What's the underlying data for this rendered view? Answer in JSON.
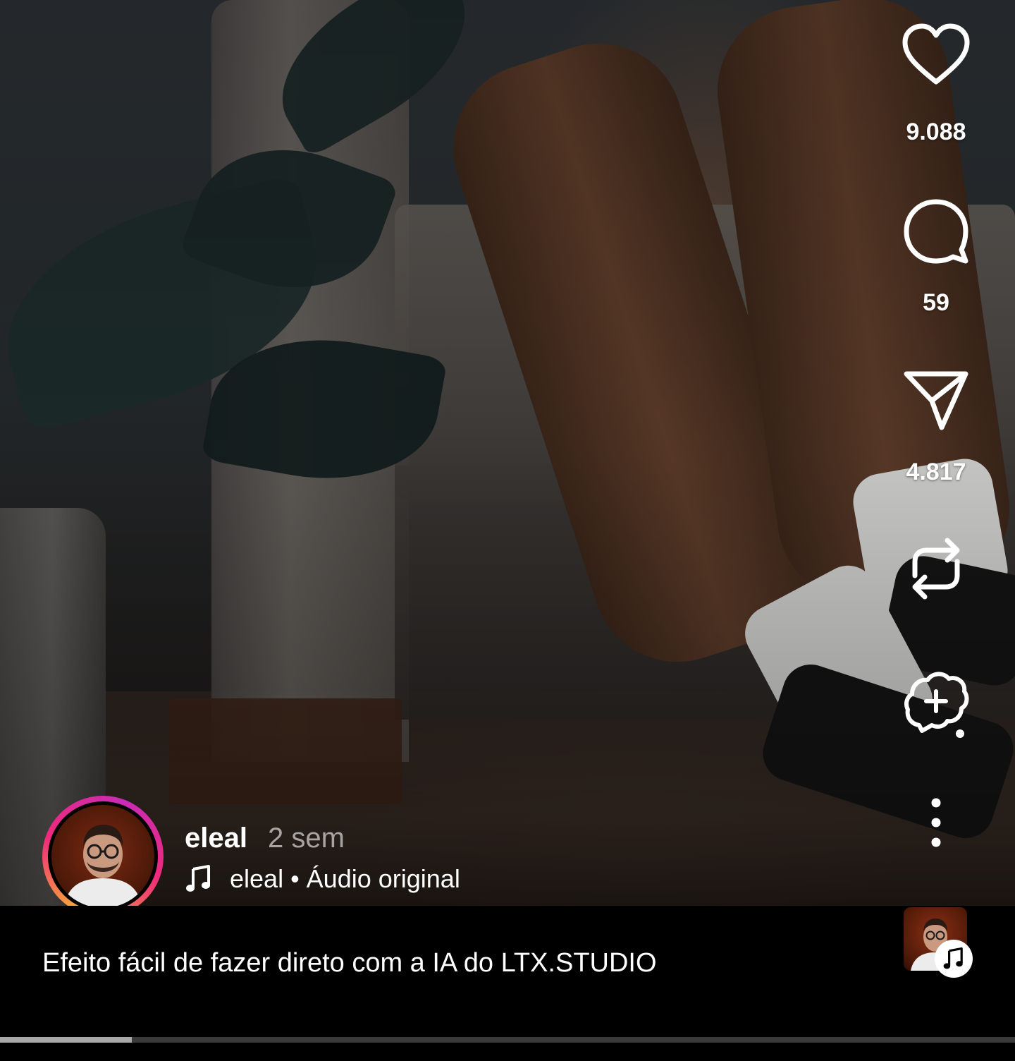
{
  "actions": {
    "like": {
      "icon": "heart-icon",
      "count": "9.088"
    },
    "comment": {
      "icon": "comment-icon",
      "count": "59"
    },
    "share": {
      "icon": "send-icon",
      "count": "4.817"
    },
    "repost": {
      "icon": "repost-icon"
    },
    "remix": {
      "icon": "add-comment-bubble-icon"
    },
    "more": {
      "icon": "more-vertical-icon"
    }
  },
  "author": {
    "username": "eleal",
    "time": "2 sem",
    "audio_owner": "eleal",
    "audio_separator": " • ",
    "audio_label": "Áudio original"
  },
  "caption": "Efeito fácil de fazer direto com a IA do LTX.STUDIO",
  "progress": {
    "fraction": 0.13
  },
  "colors": {
    "ring_gradient": [
      "#f9b233",
      "#ee2a7b",
      "#c92bb7"
    ],
    "progress_fill": "#a8a8a8",
    "progress_track": "#3a3a3a"
  }
}
